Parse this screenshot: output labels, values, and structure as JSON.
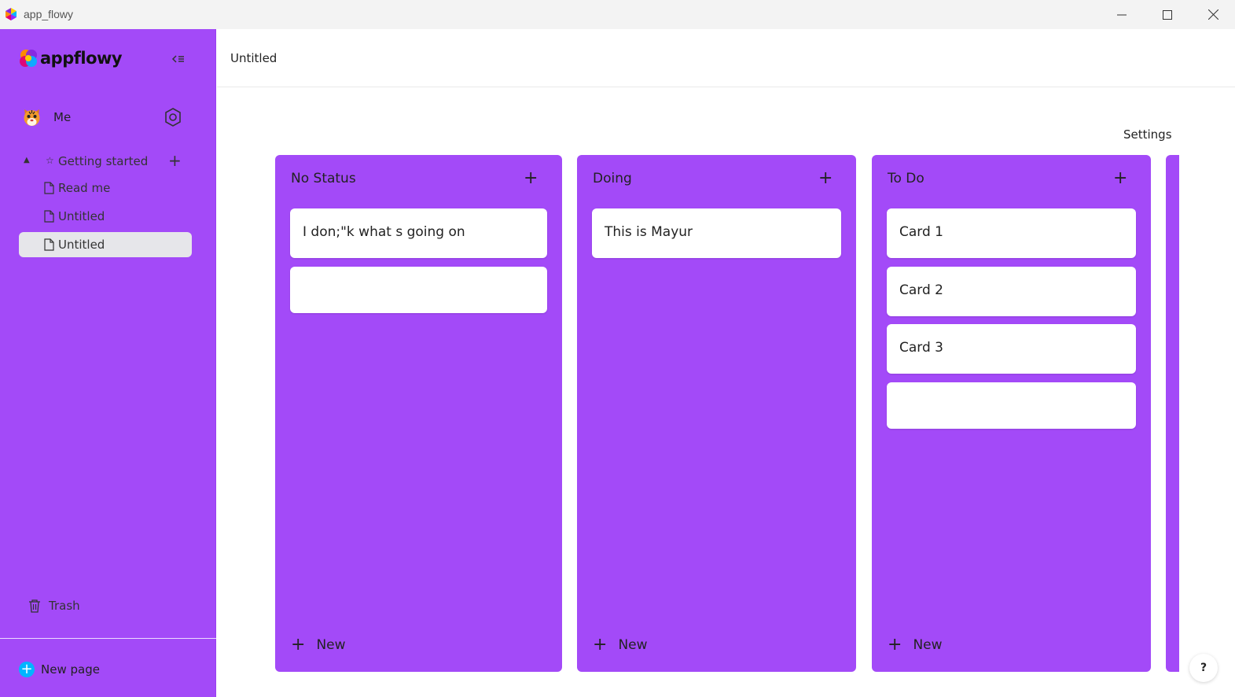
{
  "window": {
    "title": "app_flowy"
  },
  "sidebar": {
    "logo_text": "appflowy",
    "user": {
      "name": "Me"
    },
    "workspace": {
      "label": "Getting started",
      "star": "☆",
      "caret": "▲"
    },
    "pages": [
      {
        "label": "Read me",
        "selected": false
      },
      {
        "label": "Untitled",
        "selected": false
      },
      {
        "label": "Untitled",
        "selected": true
      }
    ],
    "trash_label": "Trash",
    "new_page_label": "New page",
    "colors": {
      "background": "#a34af8",
      "selected_item": "#e6e6ea",
      "new_page_icon": "#00b5ff"
    }
  },
  "main": {
    "breadcrumb": "Untitled",
    "settings_label": "Settings",
    "board": {
      "columns": [
        {
          "title": "No Status",
          "cards": [
            "I don;\"k what s going on",
            ""
          ],
          "new_label": "New"
        },
        {
          "title": "Doing",
          "cards": [
            "This is Mayur"
          ],
          "new_label": "New"
        },
        {
          "title": "To Do",
          "cards": [
            "Card 1",
            "Card 2",
            "Card 3",
            ""
          ],
          "new_label": "New"
        }
      ],
      "column_color": "#a34af8"
    }
  },
  "help_label": "?"
}
